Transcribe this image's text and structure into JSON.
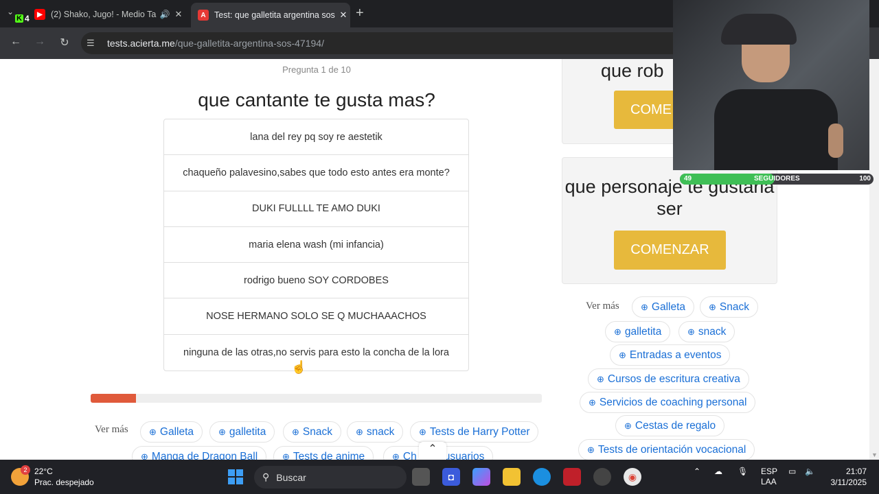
{
  "browser": {
    "tabs": [
      {
        "title": "(2) Shako, Jugo! - Medio Ta",
        "favicon": "youtube-icon",
        "muted_icon": "speaker-icon",
        "active": false
      },
      {
        "title": "Test: que galletita argentina sos",
        "favicon": "acierta-icon",
        "active": true
      }
    ],
    "kick_badge": {
      "label": "K",
      "count": "4"
    },
    "url_host": "tests.acierta.me",
    "url_path": "/que-galletita-argentina-sos-47194/"
  },
  "quiz": {
    "counter": "Pregunta 1 de 10",
    "question": "que cantante te gusta mas?",
    "answers": [
      "lana del rey pq soy re aestetik",
      "chaqueño palavesino,sabes que todo esto antes era monte?",
      "DUKI FULLLL TE AMO DUKI",
      "maria elena wash (mi infancia)",
      "rodrigo bueno SOY CORDOBES",
      "NOSE HERMANO SOLO SE Q MUCHAAACHOS",
      "ninguna de las otras,no servis para esto la concha de la lora"
    ],
    "progress": 0.1,
    "progress_color": "#e05a3b"
  },
  "bottom_more": {
    "label": "Ver más",
    "chips": [
      "Galleta",
      "galletita",
      "Snack",
      "snack",
      "Tests de Harry Potter",
      "Manga de Dragon Ball",
      "Tests de anime",
      "Ch",
      "usuarios"
    ]
  },
  "sidebar": {
    "card1": {
      "title": "que rob",
      "button": "COME"
    },
    "card2": {
      "title": "que personaje te gustaria ser",
      "button": "COMENZAR"
    },
    "more_label": "Ver más",
    "chips": [
      "Galleta",
      "Snack",
      "galletita",
      "snack",
      "Entradas a eventos",
      "Cursos de escritura creativa",
      "Servicios de coaching personal",
      "Cestas de regalo",
      "Tests de orientación vocacional"
    ]
  },
  "stream_overlay": {
    "followers_current": "49",
    "followers_label": "SEGUIDORES",
    "followers_goal": "100",
    "followers_fraction": 0.49
  },
  "taskbar": {
    "weather_temp": "22°C",
    "weather_desc": "Prac. despejado",
    "weather_badge": "2",
    "search_placeholder": "Buscar",
    "lang_top": "ESP",
    "lang_bottom": "LAA",
    "time": "21:07",
    "date": "3/11/2025"
  },
  "colors": {
    "accent_yellow": "#e7b93c",
    "chip_blue": "#1a6fd6"
  }
}
